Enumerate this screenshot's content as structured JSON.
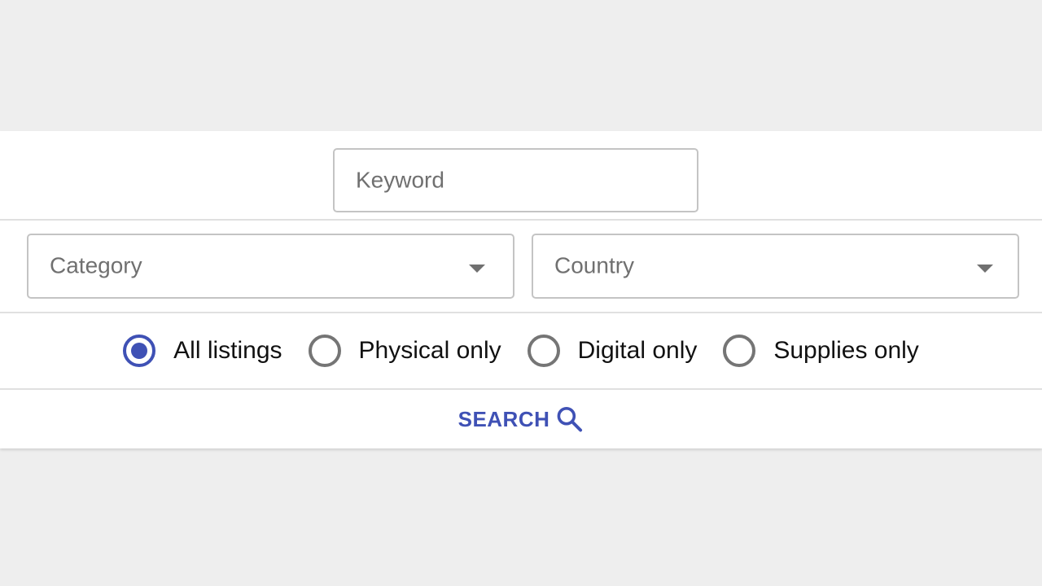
{
  "search_form": {
    "keyword": {
      "placeholder": "Keyword",
      "value": ""
    },
    "category_select": {
      "placeholder": "Category",
      "selected": "",
      "icon": "caret-down-icon"
    },
    "country_select": {
      "placeholder": "Country",
      "selected": "",
      "icon": "caret-down-icon"
    },
    "listing_type": {
      "selected": "All listings",
      "options": [
        {
          "label": "All listings",
          "checked": true
        },
        {
          "label": "Physical only",
          "checked": false
        },
        {
          "label": "Digital only",
          "checked": false
        },
        {
          "label": "Supplies only",
          "checked": false
        }
      ]
    },
    "search_button": {
      "label": "SEARCH",
      "icon": "search-icon"
    }
  },
  "colors": {
    "accent": "#3f51b5",
    "background": "#eeeeee",
    "card": "#ffffff",
    "border": "#c4c4c4",
    "placeholder_text": "#707070",
    "radio_unchecked": "#757575"
  }
}
